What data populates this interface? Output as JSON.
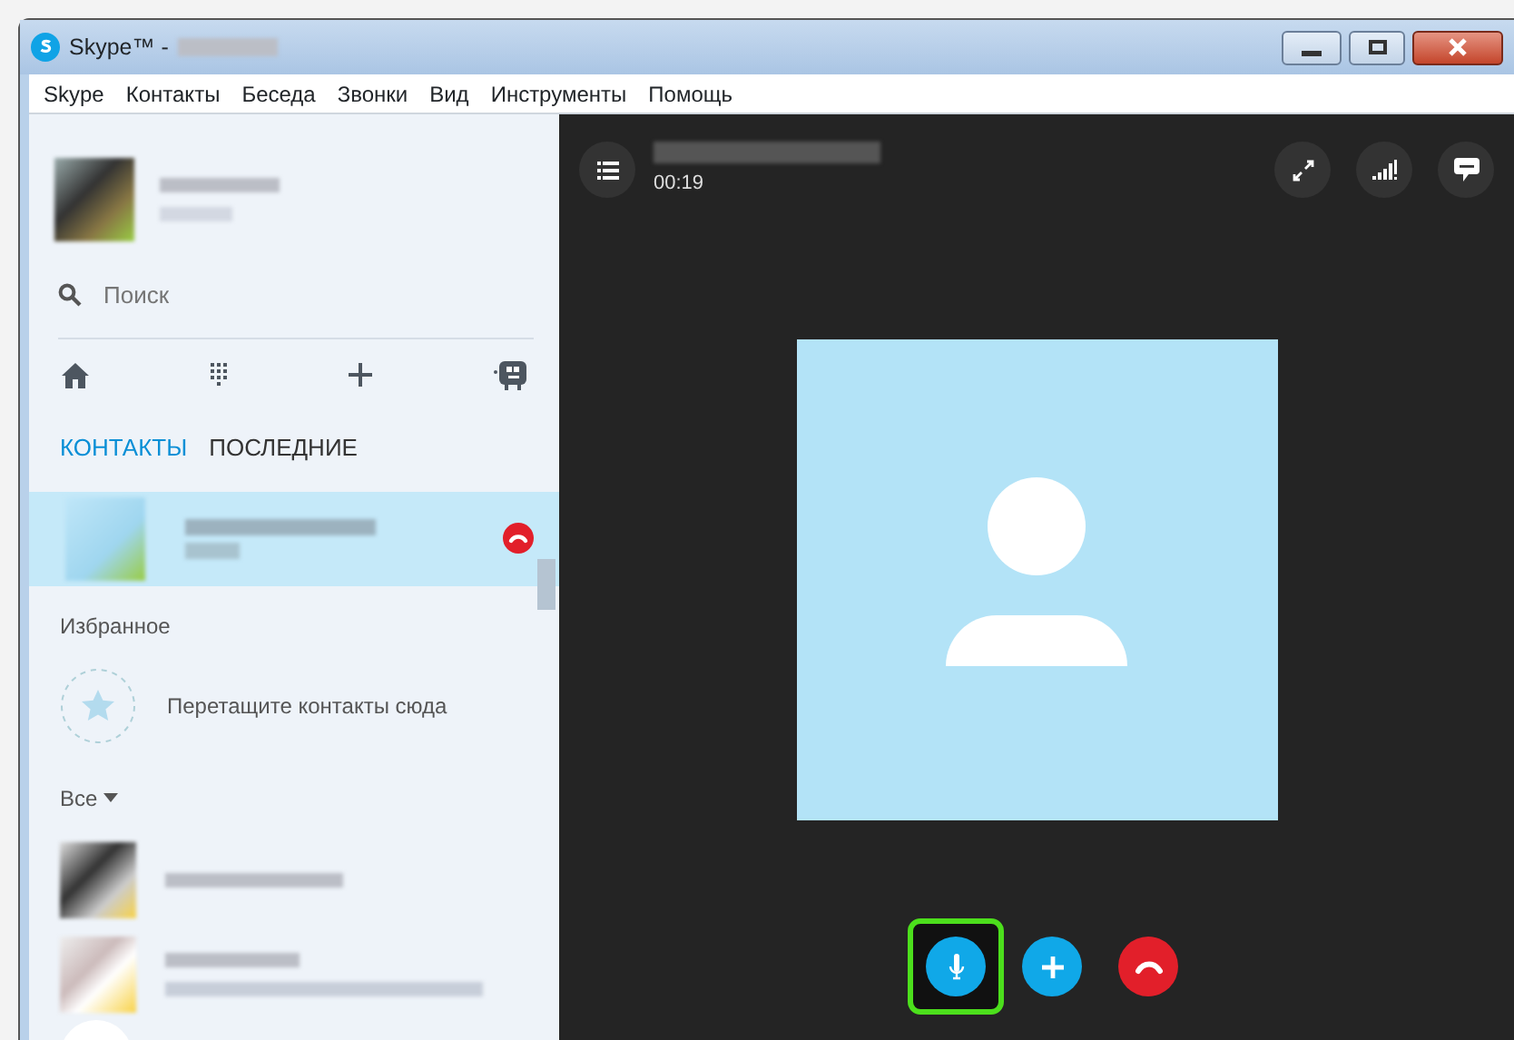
{
  "window": {
    "title": "Skype™ -"
  },
  "menu": [
    "Skype",
    "Контакты",
    "Беседа",
    "Звонки",
    "Вид",
    "Инструменты",
    "Помощь"
  ],
  "search": {
    "placeholder": "Поиск"
  },
  "tabs": [
    {
      "label": "КОНТАКТЫ",
      "selected": true
    },
    {
      "label": "ПОСЛЕДНИЕ",
      "selected": false
    }
  ],
  "active_call": {
    "selected": true
  },
  "favorites": {
    "heading": "Избранное",
    "hint": "Перетащите контакты сюда"
  },
  "filter": {
    "label": "Все"
  },
  "call": {
    "timer": "00:19",
    "controls": [
      {
        "kind": "mic",
        "highlighted": true
      },
      {
        "kind": "add",
        "highlighted": false
      },
      {
        "kind": "hangup",
        "highlighted": false
      }
    ]
  }
}
